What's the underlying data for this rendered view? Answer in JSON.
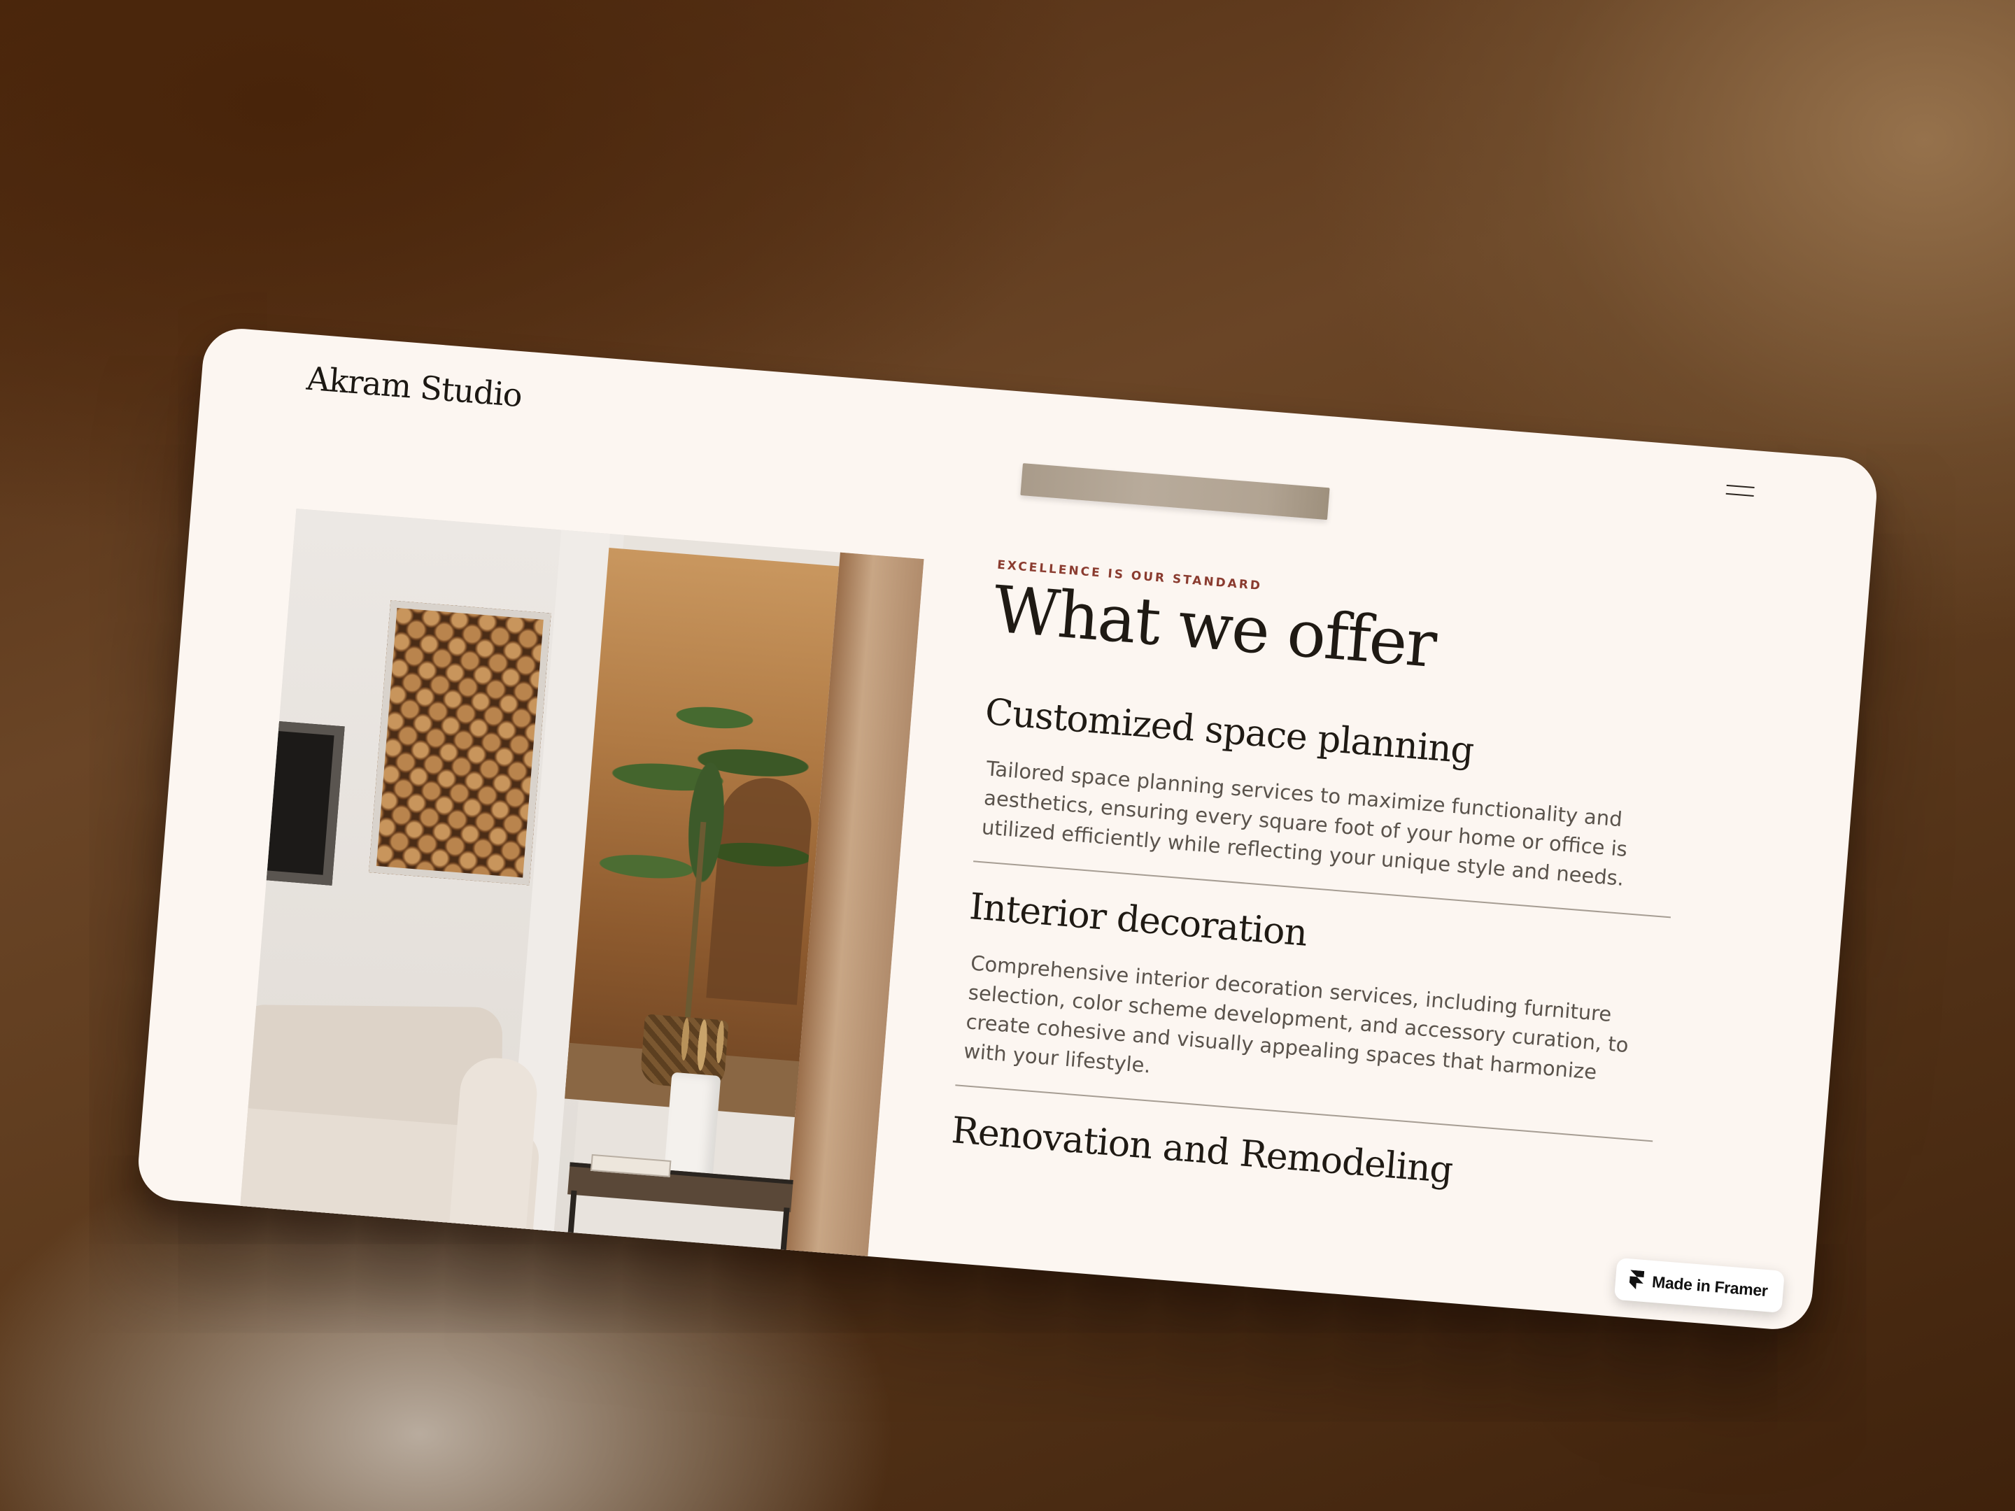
{
  "site": {
    "logo": "Akram Studio"
  },
  "hero": {
    "eyebrow": "EXCELLENCE IS OUR STANDARD",
    "heading": "What we offer"
  },
  "offers": [
    {
      "title": "Customized space planning",
      "description": "Tailored space planning services to maximize functionality and aesthetics, ensuring every square foot of your home or office is utilized efficiently while reflecting your unique style and needs."
    },
    {
      "title": "Interior decoration",
      "description": "Comprehensive interior decoration services, including furniture selection, color scheme development, and accessory curation, to create cohesive and visually appealing spaces that harmonize with your lifestyle."
    },
    {
      "title": "Renovation and Remodeling"
    }
  ],
  "badge": {
    "label": "Made in Framer"
  },
  "icons": {
    "menu": "hamburger-menu-icon",
    "framer": "framer-logo-icon"
  },
  "colors": {
    "page_bg": "#fcf6f1",
    "eyebrow": "#8a3b2f",
    "text_dark": "#1f1a14",
    "text_body": "#5a534c"
  }
}
